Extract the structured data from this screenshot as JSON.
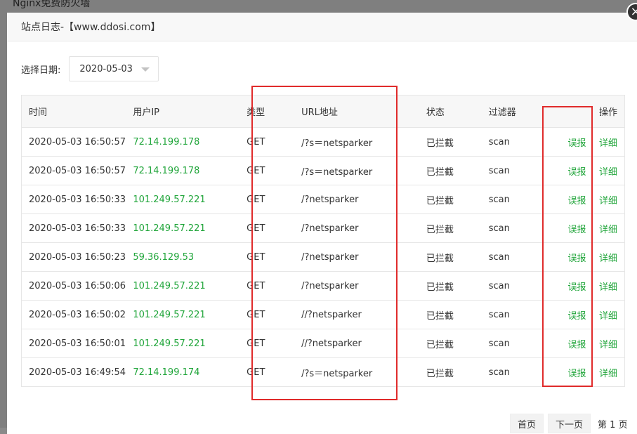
{
  "background_title": "Nginx免费防火墙",
  "modal": {
    "title": "站点日志-【www.ddosi.com】",
    "close_glyph": "×"
  },
  "filter": {
    "label": "选择日期:",
    "date_value": "2020-05-03"
  },
  "table": {
    "headers": {
      "time": "时间",
      "ip": "用户IP",
      "type": "类型",
      "url": "URL地址",
      "status": "状态",
      "filter": "过滤器",
      "ops": "操作"
    },
    "rows": [
      {
        "time": "2020-05-03 16:50:57",
        "ip": "72.14.199.178",
        "type": "GET",
        "url": "/?s＝netsparker",
        "status": "已拦截",
        "filter": "scan",
        "report": "误报",
        "detail": "详细"
      },
      {
        "time": "2020-05-03 16:50:57",
        "ip": "72.14.199.178",
        "type": "GET",
        "url": "/?s＝netsparker",
        "status": "已拦截",
        "filter": "scan",
        "report": "误报",
        "detail": "详细"
      },
      {
        "time": "2020-05-03 16:50:33",
        "ip": "101.249.57.221",
        "type": "GET",
        "url": "/?netsparker",
        "status": "已拦截",
        "filter": "scan",
        "report": "误报",
        "detail": "详细"
      },
      {
        "time": "2020-05-03 16:50:33",
        "ip": "101.249.57.221",
        "type": "GET",
        "url": "/?netsparker",
        "status": "已拦截",
        "filter": "scan",
        "report": "误报",
        "detail": "详细"
      },
      {
        "time": "2020-05-03 16:50:23",
        "ip": "59.36.129.53",
        "type": "GET",
        "url": "/?netsparker",
        "status": "已拦截",
        "filter": "scan",
        "report": "误报",
        "detail": "详细"
      },
      {
        "time": "2020-05-03 16:50:06",
        "ip": "101.249.57.221",
        "type": "GET",
        "url": "/?netsparker",
        "status": "已拦截",
        "filter": "scan",
        "report": "误报",
        "detail": "详细"
      },
      {
        "time": "2020-05-03 16:50:02",
        "ip": "101.249.57.221",
        "type": "GET",
        "url": "//?netsparker",
        "status": "已拦截",
        "filter": "scan",
        "report": "误报",
        "detail": "详细"
      },
      {
        "time": "2020-05-03 16:50:01",
        "ip": "101.249.57.221",
        "type": "GET",
        "url": "//?netsparker",
        "status": "已拦截",
        "filter": "scan",
        "report": "误报",
        "detail": "详细"
      },
      {
        "time": "2020-05-03 16:49:54",
        "ip": "72.14.199.174",
        "type": "GET",
        "url": "/?s＝netsparker",
        "status": "已拦截",
        "filter": "scan",
        "report": "误报",
        "detail": "详细"
      }
    ]
  },
  "pager": {
    "first": "首页",
    "next": "下一页",
    "current": "第 1 页"
  },
  "colors": {
    "accent_green": "#20a53a",
    "highlight_red": "#e02b2b"
  }
}
